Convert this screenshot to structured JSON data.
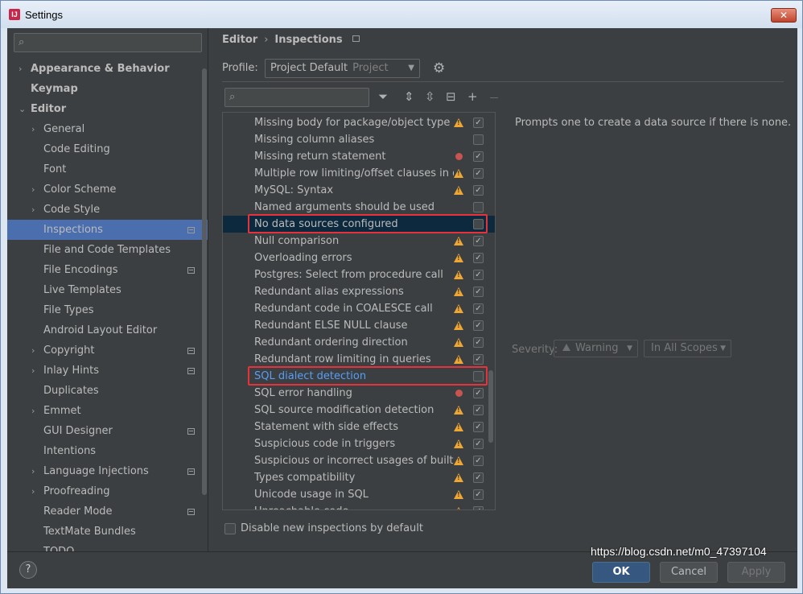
{
  "window": {
    "title": "Settings",
    "close_label": "✕"
  },
  "sidebar": {
    "items": [
      {
        "label": "Appearance & Behavior",
        "level": 0,
        "arrow": "›",
        "bold": true
      },
      {
        "label": "Keymap",
        "level": 0,
        "arrow": "",
        "bold": true
      },
      {
        "label": "Editor",
        "level": 0,
        "arrow": "⌄",
        "bold": true
      },
      {
        "label": "General",
        "level": 1,
        "arrow": "›"
      },
      {
        "label": "Code Editing",
        "level": 1,
        "arrow": ""
      },
      {
        "label": "Font",
        "level": 1,
        "arrow": ""
      },
      {
        "label": "Color Scheme",
        "level": 1,
        "arrow": "›"
      },
      {
        "label": "Code Style",
        "level": 1,
        "arrow": "›"
      },
      {
        "label": "Inspections",
        "level": 1,
        "arrow": "",
        "selected": true,
        "page_icon": true
      },
      {
        "label": "File and Code Templates",
        "level": 1,
        "arrow": ""
      },
      {
        "label": "File Encodings",
        "level": 1,
        "arrow": "",
        "page_icon": true
      },
      {
        "label": "Live Templates",
        "level": 1,
        "arrow": ""
      },
      {
        "label": "File Types",
        "level": 1,
        "arrow": ""
      },
      {
        "label": "Android Layout Editor",
        "level": 1,
        "arrow": ""
      },
      {
        "label": "Copyright",
        "level": 1,
        "arrow": "›",
        "page_icon": true
      },
      {
        "label": "Inlay Hints",
        "level": 1,
        "arrow": "›",
        "page_icon": true
      },
      {
        "label": "Duplicates",
        "level": 1,
        "arrow": ""
      },
      {
        "label": "Emmet",
        "level": 1,
        "arrow": "›"
      },
      {
        "label": "GUI Designer",
        "level": 1,
        "arrow": "",
        "page_icon": true
      },
      {
        "label": "Intentions",
        "level": 1,
        "arrow": ""
      },
      {
        "label": "Language Injections",
        "level": 1,
        "arrow": "›",
        "page_icon": true
      },
      {
        "label": "Proofreading",
        "level": 1,
        "arrow": "›"
      },
      {
        "label": "Reader Mode",
        "level": 1,
        "arrow": "",
        "page_icon": true
      },
      {
        "label": "TextMate Bundles",
        "level": 1,
        "arrow": ""
      },
      {
        "label": "TODO",
        "level": 1,
        "arrow": ""
      }
    ]
  },
  "breadcrumb": {
    "part1": "Editor",
    "separator": "›",
    "part2": "Inspections"
  },
  "profile": {
    "label": "Profile:",
    "value": "Project Default",
    "sub": "Project"
  },
  "inspections": [
    {
      "name": "Missing body for package/object type specification",
      "icon": "warn",
      "checked": true
    },
    {
      "name": "Missing column aliases",
      "icon": "",
      "checked": false
    },
    {
      "name": "Missing return statement",
      "icon": "err",
      "checked": true
    },
    {
      "name": "Multiple row limiting/offset clauses in queries",
      "icon": "warn",
      "checked": true
    },
    {
      "name": "MySQL: Syntax",
      "icon": "warn",
      "checked": true
    },
    {
      "name": "Named arguments should be used",
      "icon": "",
      "checked": false
    },
    {
      "name": "No data sources configured",
      "icon": "",
      "checked": false,
      "selected": true,
      "highlight": true
    },
    {
      "name": "Null comparison",
      "icon": "warn",
      "checked": true
    },
    {
      "name": "Overloading errors",
      "icon": "warn",
      "checked": true
    },
    {
      "name": "Postgres: Select from procedure call",
      "icon": "warn",
      "checked": true
    },
    {
      "name": "Redundant alias expressions",
      "icon": "warn",
      "checked": true
    },
    {
      "name": "Redundant code in COALESCE call",
      "icon": "warn",
      "checked": true
    },
    {
      "name": "Redundant ELSE NULL clause",
      "icon": "warn",
      "checked": true
    },
    {
      "name": "Redundant ordering direction",
      "icon": "warn",
      "checked": true
    },
    {
      "name": "Redundant row limiting in queries",
      "icon": "warn",
      "checked": true
    },
    {
      "name": "SQL dialect detection",
      "icon": "",
      "checked": false,
      "link": true,
      "highlight": true
    },
    {
      "name": "SQL error handling",
      "icon": "err",
      "checked": true
    },
    {
      "name": "SQL source modification detection",
      "icon": "warn",
      "checked": true
    },
    {
      "name": "Statement with side effects",
      "icon": "warn",
      "checked": true
    },
    {
      "name": "Suspicious code in triggers",
      "icon": "warn",
      "checked": true
    },
    {
      "name": "Suspicious or incorrect usages of built-in functions",
      "icon": "warn",
      "checked": true
    },
    {
      "name": "Types compatibility",
      "icon": "warn",
      "checked": true
    },
    {
      "name": "Unicode usage in SQL",
      "icon": "warn",
      "checked": true
    },
    {
      "name": "Unreachable code",
      "icon": "warn",
      "checked": true
    }
  ],
  "description": "Prompts one to create a data source if there is none.",
  "severity": {
    "label": "Severity:",
    "value": "Warning",
    "scope": "In All Scopes"
  },
  "disable_new": "Disable new inspections by default",
  "buttons": {
    "help": "?",
    "ok": "OK",
    "cancel": "Cancel",
    "apply": "Apply"
  },
  "watermark": "https://blog.csdn.net/m0_47397104",
  "colors": {
    "selection": "#4b6eaf",
    "highlight_box": "#e8323b",
    "warning": "#f0a732",
    "error": "#c75450",
    "link": "#589df6"
  }
}
